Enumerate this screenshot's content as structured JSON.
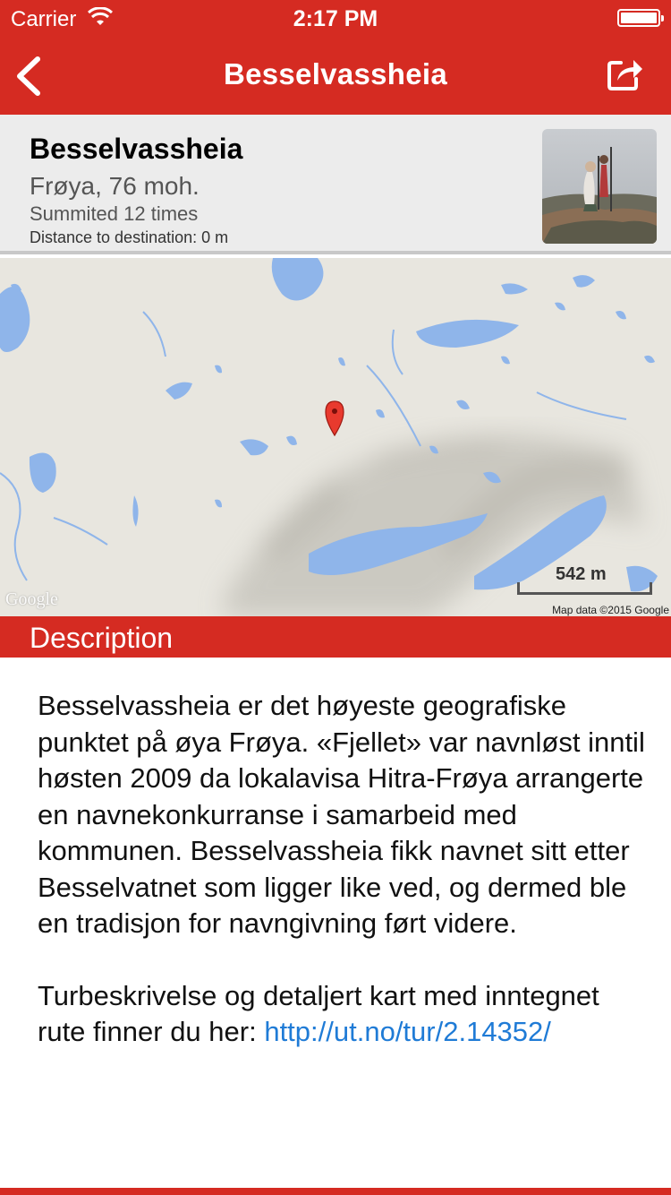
{
  "status_bar": {
    "carrier": "Carrier",
    "time": "2:17 PM",
    "wifi_icon": "wifi-icon",
    "battery_icon": "battery-icon"
  },
  "nav": {
    "title": "Besselvassheia",
    "back_icon": "chevron-left-icon",
    "share_icon": "share-icon"
  },
  "summit": {
    "name": "Besselvassheia",
    "location": "Frøya, 76 moh.",
    "summited": "Summited 12 times",
    "distance": "Distance to destination: 0 m"
  },
  "map": {
    "logo": "Google",
    "scale": "542 m",
    "attribution": "Map data ©2015 Google",
    "pin_icon": "map-pin-icon"
  },
  "description": {
    "header": "Description",
    "paragraph1": "Besselvassheia er det høyeste geografiske punktet på øya Frøya. «Fjellet» var navnløst inntil høsten 2009 da lokalavisa Hitra-Frøya arrangerte en navnekonkurranse i samarbeid med kommunen. Besselvassheia fikk navnet sitt etter Besselvatnet som ligger like ved, og dermed ble en tradisjon for navngivning ført videre.",
    "paragraph2_text": "Turbeskrivelse og detaljert kart med inntegnet rute finner du her: ",
    "paragraph2_link": "http://ut.no/tur/2.14352/"
  },
  "colors": {
    "brand_red": "#d52b22",
    "link_blue": "#1f7bd6",
    "water_blue": "#8fb5ea"
  }
}
